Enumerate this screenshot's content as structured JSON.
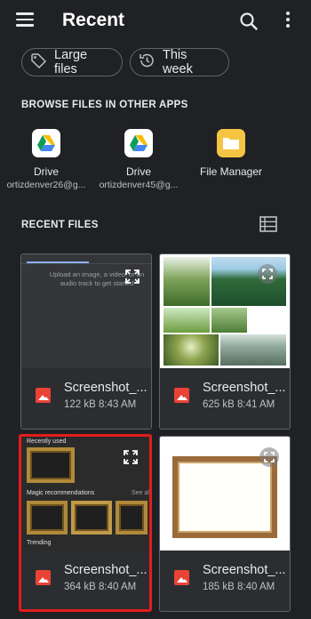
{
  "appbar": {
    "title": "Recent",
    "icons": [
      "menu-icon",
      "search-icon",
      "more-vert-icon"
    ]
  },
  "chips": [
    {
      "label": "Large files",
      "icon": "tag-icon"
    },
    {
      "label": "This week",
      "icon": "history-icon"
    }
  ],
  "browse": {
    "header": "BROWSE FILES IN OTHER APPS",
    "apps": [
      {
        "name": "Drive",
        "account": "ortizdenver26@g...",
        "icon": "google-drive-icon"
      },
      {
        "name": "Drive",
        "account": "ortizdenver45@g...",
        "icon": "google-drive-icon"
      },
      {
        "name": "File Manager",
        "account": "",
        "icon": "folder-icon"
      }
    ]
  },
  "recent": {
    "header": "RECENT FILES",
    "view_toggle_icon": "list-view-icon",
    "files": [
      {
        "name": "Screenshot_...",
        "meta": "122 kB 8:43 AM",
        "thumb_text": "Upload an image, a video, or an audio track to get started"
      },
      {
        "name": "Screenshot_...",
        "meta": "625 kB 8:41 AM"
      },
      {
        "name": "Screenshot_...",
        "meta": "364 kB 8:40 AM",
        "thumb_labels": [
          "Recently used",
          "Magic recommendations",
          "See all",
          "Trending"
        ]
      },
      {
        "name": "Screenshot_...",
        "meta": "185 kB 8:40 AM"
      }
    ]
  },
  "colors": {
    "background": "#202124",
    "card": "#2c2d30",
    "selection": "#e21d1d",
    "image_icon": "#ea4335",
    "file_manager": "#f6c443"
  }
}
